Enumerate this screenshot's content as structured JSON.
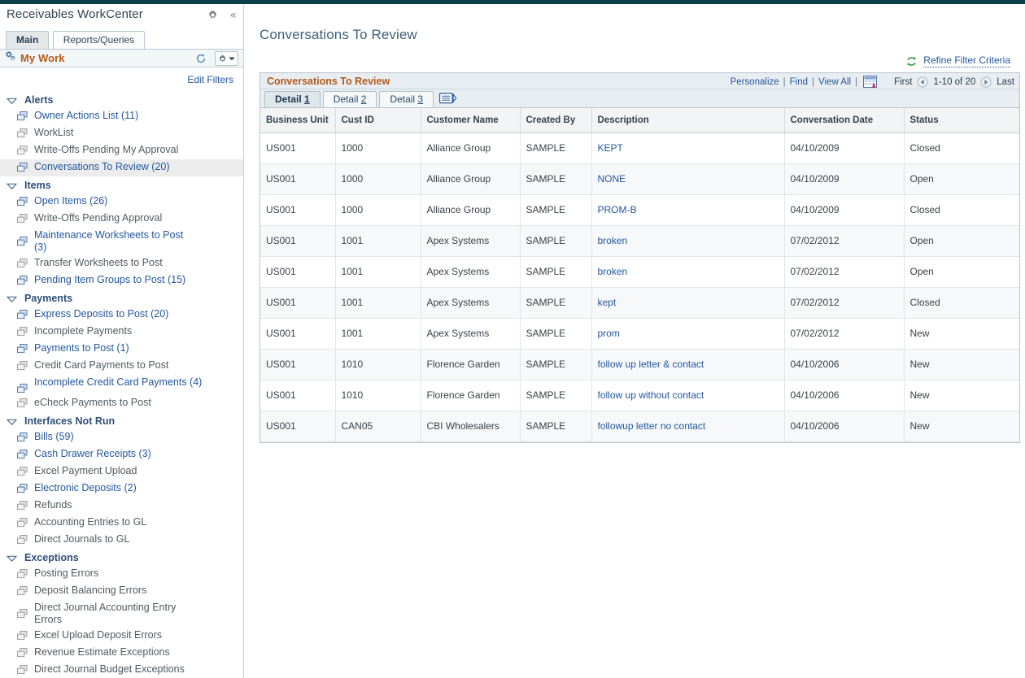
{
  "theme": {
    "top_bar_color": "#0b3f4a",
    "link_color": "#2257a0",
    "grid_title_color": "#b3591a",
    "page_title_color": "#41607e",
    "grid_header_bg": "#e7edf1"
  },
  "sidebar": {
    "title": "Receivables WorkCenter",
    "gear_icon": "gear-icon",
    "collapse_icon": "collapse-chevrons-icon",
    "tabs": [
      {
        "label": "Main",
        "active": true
      },
      {
        "label": "Reports/Queries",
        "active": false
      }
    ],
    "mywork": {
      "icon": "gears-icon",
      "label": "My Work",
      "refresh_icon": "refresh-icon",
      "options_icon": "gear-dropdown-icon"
    },
    "edit_filters_label": "Edit Filters",
    "resize_handle": "· · · · · · · · ·",
    "groups": [
      {
        "label": "Alerts",
        "expanded": true,
        "items": [
          {
            "label": "Owner Actions List (11)",
            "link": true,
            "selected": false
          },
          {
            "label": "WorkList",
            "link": false,
            "selected": false
          },
          {
            "label": "Write-Offs Pending My Approval",
            "link": false,
            "selected": false
          },
          {
            "label": "Conversations To Review (20)",
            "link": true,
            "selected": true
          }
        ]
      },
      {
        "label": "Items",
        "expanded": true,
        "items": [
          {
            "label": "Open Items (26)",
            "link": true,
            "selected": false
          },
          {
            "label": "Write-Offs Pending Approval",
            "link": false,
            "selected": false
          },
          {
            "label": "Maintenance Worksheets to Post (3)",
            "link": true,
            "selected": false
          },
          {
            "label": "Transfer Worksheets to Post",
            "link": false,
            "selected": false
          },
          {
            "label": "Pending Item Groups to Post (15)",
            "link": true,
            "selected": false
          }
        ]
      },
      {
        "label": "Payments",
        "expanded": true,
        "items": [
          {
            "label": "Express Deposits to Post (20)",
            "link": true,
            "selected": false
          },
          {
            "label": "Incomplete Payments",
            "link": false,
            "selected": false
          },
          {
            "label": "Payments to Post (1)",
            "link": true,
            "selected": false
          },
          {
            "label": "Credit Card Payments to Post",
            "link": false,
            "selected": false
          },
          {
            "label": "Incomplete Credit Card Payments (4)",
            "link": true,
            "selected": false
          },
          {
            "label": "eCheck Payments to Post",
            "link": false,
            "selected": false
          }
        ]
      },
      {
        "label": "Interfaces Not Run",
        "expanded": true,
        "items": [
          {
            "label": "Bills (59)",
            "link": true,
            "selected": false
          },
          {
            "label": "Cash Drawer Receipts (3)",
            "link": true,
            "selected": false
          },
          {
            "label": "Excel Payment Upload",
            "link": false,
            "selected": false
          },
          {
            "label": "Electronic Deposits (2)",
            "link": true,
            "selected": false
          },
          {
            "label": "Refunds",
            "link": false,
            "selected": false
          },
          {
            "label": "Accounting Entries to GL",
            "link": false,
            "selected": false
          },
          {
            "label": "Direct Journals to GL",
            "link": false,
            "selected": false
          }
        ]
      },
      {
        "label": "Exceptions",
        "expanded": true,
        "items": [
          {
            "label": "Posting Errors",
            "link": false,
            "selected": false
          },
          {
            "label": "Deposit Balancing Errors",
            "link": false,
            "selected": false
          },
          {
            "label": "Direct Journal Accounting Entry Errors",
            "link": false,
            "selected": false
          },
          {
            "label": "Excel Upload Deposit Errors",
            "link": false,
            "selected": false
          },
          {
            "label": "Revenue Estimate Exceptions",
            "link": false,
            "selected": false
          },
          {
            "label": "Direct Journal Budget Exceptions",
            "link": false,
            "selected": false
          }
        ]
      }
    ]
  },
  "main": {
    "page_title": "Conversations To Review",
    "refine": {
      "icon": "refresh-circular-arrows-icon",
      "label": "Refine Filter Criteria"
    },
    "grid": {
      "title": "Conversations To Review",
      "tools": {
        "personalize": "Personalize",
        "find": "Find",
        "view_all": "View All",
        "sep": "|",
        "download_icon": "download-spreadsheet-icon"
      },
      "pager": {
        "first": "First",
        "prev_icon": "prev-arrow-icon",
        "range": "1-10 of 20",
        "next_icon": "next-arrow-icon",
        "last": "Last"
      },
      "detail_tabs": [
        {
          "label": "Detail ",
          "accel": "1",
          "active": true
        },
        {
          "label": "Detail ",
          "accel": "2",
          "active": false
        },
        {
          "label": "Detail ",
          "accel": "3",
          "active": false
        }
      ],
      "expand_icon": "expand-grid-icon",
      "columns": [
        "Business Unit",
        "Cust ID",
        "Customer Name",
        "Created By",
        "Description",
        "Conversation Date",
        "Status"
      ],
      "rows": [
        {
          "business_unit": "US001",
          "cust_id": "1000",
          "customer_name": "Alliance Group",
          "created_by": "SAMPLE",
          "description": "KEPT",
          "conversation_date": "04/10/2009",
          "status": "Closed"
        },
        {
          "business_unit": "US001",
          "cust_id": "1000",
          "customer_name": "Alliance Group",
          "created_by": "SAMPLE",
          "description": "NONE",
          "conversation_date": "04/10/2009",
          "status": "Open"
        },
        {
          "business_unit": "US001",
          "cust_id": "1000",
          "customer_name": "Alliance Group",
          "created_by": "SAMPLE",
          "description": "PROM-B",
          "conversation_date": "04/10/2009",
          "status": "Closed"
        },
        {
          "business_unit": "US001",
          "cust_id": "1001",
          "customer_name": "Apex Systems",
          "created_by": "SAMPLE",
          "description": "broken",
          "conversation_date": "07/02/2012",
          "status": "Open"
        },
        {
          "business_unit": "US001",
          "cust_id": "1001",
          "customer_name": "Apex Systems",
          "created_by": "SAMPLE",
          "description": "broken",
          "conversation_date": "07/02/2012",
          "status": "Open"
        },
        {
          "business_unit": "US001",
          "cust_id": "1001",
          "customer_name": "Apex Systems",
          "created_by": "SAMPLE",
          "description": "kept",
          "conversation_date": "07/02/2012",
          "status": "Closed"
        },
        {
          "business_unit": "US001",
          "cust_id": "1001",
          "customer_name": "Apex Systems",
          "created_by": "SAMPLE",
          "description": "prom",
          "conversation_date": "07/02/2012",
          "status": "New"
        },
        {
          "business_unit": "US001",
          "cust_id": "1010",
          "customer_name": "Florence Garden",
          "created_by": "SAMPLE",
          "description": "follow up letter & contact",
          "conversation_date": "04/10/2006",
          "status": "New"
        },
        {
          "business_unit": "US001",
          "cust_id": "1010",
          "customer_name": "Florence Garden",
          "created_by": "SAMPLE",
          "description": "follow up without contact",
          "conversation_date": "04/10/2006",
          "status": "New"
        },
        {
          "business_unit": "US001",
          "cust_id": "CAN05",
          "customer_name": "CBI Wholesalers",
          "created_by": "SAMPLE",
          "description": "followup letter no contact",
          "conversation_date": "04/10/2006",
          "status": "New"
        }
      ]
    }
  }
}
